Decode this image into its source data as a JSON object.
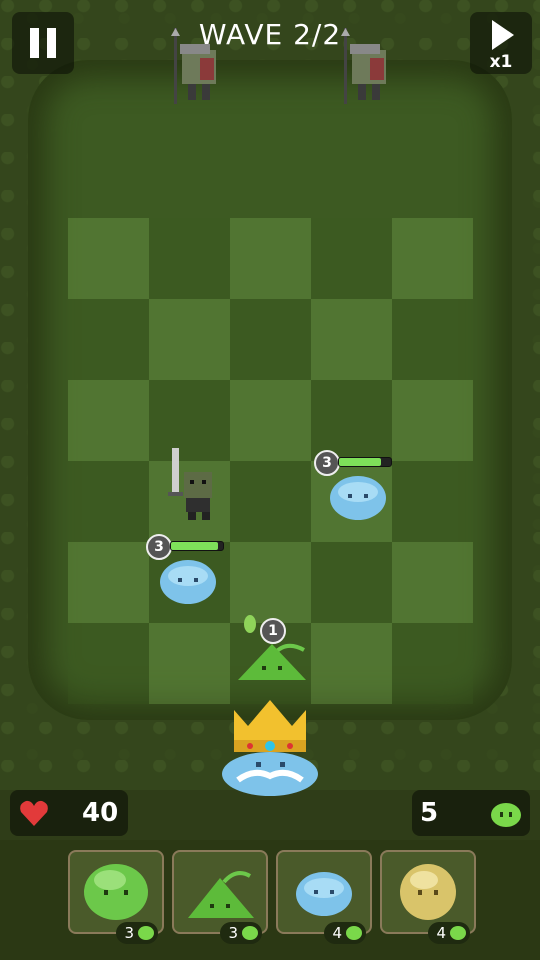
{
  "hud": {
    "wave_label": "WAVE 2/2",
    "speed_label": "x1",
    "lives": "40",
    "slime_currency": "5"
  },
  "board": {
    "cols": 5,
    "rows": 6
  },
  "units": [
    {
      "name": "enemy-orc-spearman",
      "color": "#6e7a5a"
    },
    {
      "name": "enemy-orc-spearman",
      "color": "#6e7a5a"
    },
    {
      "name": "enemy-orc-swordsman",
      "color": "#5d6b45"
    },
    {
      "name": "ally-blue-slime",
      "level": "3",
      "hp": 0.8
    },
    {
      "name": "ally-blue-slime",
      "level": "3",
      "hp": 0.9
    },
    {
      "name": "ally-green-sprout-slime",
      "level": "1"
    },
    {
      "name": "king-slime"
    }
  ],
  "shop": [
    {
      "name": "green-slime",
      "cost": "3",
      "color": "#6cc84a"
    },
    {
      "name": "sprout-slime",
      "cost": "3",
      "color": "#5dbb3a"
    },
    {
      "name": "blue-slime",
      "cost": "4",
      "color": "#7ec3ea"
    },
    {
      "name": "yellow-slime",
      "cost": "4",
      "color": "#d9c46a"
    }
  ],
  "colors": {
    "hp_fill": "#7ee05a",
    "heart": "#e23a3a",
    "crown": "#f2c12e"
  }
}
